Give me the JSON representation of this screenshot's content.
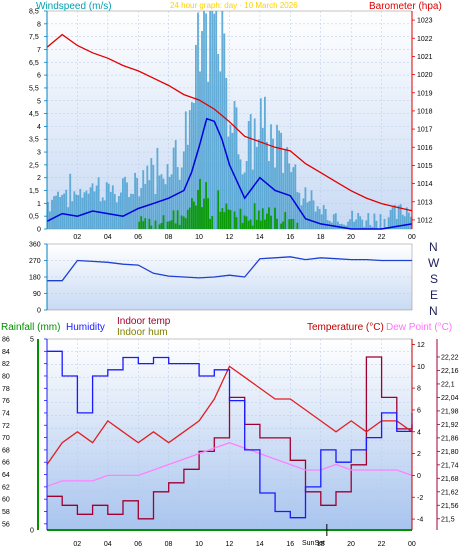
{
  "header": {
    "windspeed_label": "Windspeed (m/s)",
    "date_label": "24 hour graph: day · 10 March 2026",
    "barometer_label": "Barometer (hpa)"
  },
  "time_ticks": [
    "02",
    "04",
    "06",
    "08",
    "10",
    "12",
    "14",
    "16",
    "18",
    "20",
    "22",
    "00"
  ],
  "compass": [
    "N",
    "W",
    "S",
    "E",
    "N"
  ],
  "bottom_header": {
    "rainfall": "Rainfall (mm)",
    "humidity": "Humidity",
    "indoor_temp": "Indoor temp",
    "indoor_hum": "Indoor hum",
    "temperature": "Temperature (°C)",
    "dew_point": "Dew Point (°C)"
  },
  "sun_labels": {
    "sunset": "SunSet"
  },
  "colors": {
    "wind": "#1e90c8",
    "gust": "#4aa0d0",
    "avg": "#0000e0",
    "rain_bars": "#0a9a0a",
    "barometer": "#e00000",
    "humidity": "#1a1aff",
    "temp": "#e02020",
    "dewpoint": "#ff80ff",
    "indoor_temp": "#a00030",
    "rainfall": "#009000"
  },
  "chart_data": [
    {
      "type": "line",
      "title": "24 hour graph: day · 10 March 2026",
      "x_ticks": [
        "02",
        "04",
        "06",
        "08",
        "10",
        "12",
        "14",
        "16",
        "18",
        "20",
        "22",
        "00"
      ],
      "series": [
        {
          "name": "Windspeed (m/s)",
          "axis": "left",
          "ylim": [
            0,
            8.5
          ],
          "y_ticks": [
            "0",
            "0.5",
            "1",
            "1.5",
            "2",
            "2.5",
            "3",
            "3.5",
            "4",
            "4.5",
            "5",
            "5.5",
            "6",
            "6.5",
            "7",
            "7.5",
            "8",
            "8.5"
          ],
          "x": [
            0,
            1,
            2,
            3,
            4,
            5,
            6,
            7,
            8,
            9,
            9.5,
            10,
            10.5,
            11,
            11.5,
            12,
            13,
            14,
            15,
            16,
            17,
            18,
            19,
            20,
            21,
            22,
            23,
            24
          ],
          "values": [
            0.3,
            0.6,
            0.5,
            0.7,
            0.6,
            0.5,
            0.8,
            1.0,
            1.2,
            1.5,
            2.2,
            3.2,
            4.3,
            4.2,
            3.5,
            2.5,
            1.2,
            2.0,
            1.5,
            1.3,
            0.4,
            0.2,
            0.1,
            0.0,
            0.0,
            0.0,
            0.1,
            0.2
          ]
        },
        {
          "name": "Barometer (hpa)",
          "axis": "right",
          "ylim": [
            1011.5,
            1023.5
          ],
          "y_ticks": [
            "1012",
            "1013",
            "1014",
            "1015",
            "1016",
            "1017",
            "1018",
            "1019",
            "1020",
            "1021",
            "1022",
            "1023"
          ],
          "x": [
            0,
            1,
            2,
            3,
            4,
            5,
            6,
            7,
            8,
            9,
            10,
            11,
            12,
            13,
            14,
            15,
            16,
            17,
            18,
            19,
            20,
            21,
            22,
            23,
            24
          ],
          "values": [
            1021.5,
            1022.2,
            1021.6,
            1021.2,
            1020.9,
            1020.5,
            1020.2,
            1019.8,
            1019.4,
            1018.9,
            1018.6,
            1018.1,
            1017.4,
            1016.6,
            1016.3,
            1016.0,
            1015.8,
            1015.1,
            1014.6,
            1014.1,
            1013.6,
            1013.2,
            1012.9,
            1012.7,
            1012.5
          ]
        }
      ]
    },
    {
      "type": "line",
      "title": "",
      "x_ticks": [
        "02",
        "04",
        "06",
        "08",
        "10",
        "12",
        "14",
        "16",
        "18",
        "20",
        "22",
        "00"
      ],
      "series": [
        {
          "name": "Wind direction",
          "ylim": [
            0,
            360
          ],
          "y_ticks": [
            "0",
            "90",
            "180",
            "270",
            "360"
          ],
          "x": [
            0,
            1,
            2,
            3,
            4,
            5,
            6,
            7,
            8,
            9,
            10,
            11,
            12,
            13,
            14,
            15,
            16,
            17,
            18,
            19,
            20,
            21,
            22,
            23,
            24
          ],
          "values": [
            160,
            160,
            270,
            265,
            260,
            250,
            245,
            200,
            185,
            180,
            175,
            180,
            190,
            180,
            280,
            285,
            290,
            275,
            285,
            280,
            275,
            275,
            270,
            270,
            270
          ]
        }
      ]
    },
    {
      "type": "line",
      "title": "",
      "x_ticks": [
        "02",
        "04",
        "06",
        "08",
        "10",
        "12",
        "14",
        "16",
        "18",
        "20",
        "22",
        "00"
      ],
      "series": [
        {
          "name": "Humidity",
          "axis": "left",
          "ylim": [
            55,
            86
          ],
          "y_ticks": [
            "56",
            "58",
            "60",
            "62",
            "64",
            "66",
            "68",
            "70",
            "72",
            "74",
            "76",
            "78",
            "80",
            "82",
            "84",
            "86"
          ],
          "x": [
            0,
            1,
            2,
            3,
            4,
            5,
            6,
            7,
            8,
            9,
            10,
            11,
            12,
            13,
            14,
            15,
            16,
            17,
            18,
            19,
            20,
            21,
            22,
            23,
            24
          ],
          "values": [
            84,
            80,
            74,
            80,
            81,
            83,
            82,
            83,
            82,
            82,
            80,
            81,
            76,
            68,
            61,
            58,
            57,
            62,
            68,
            66,
            68,
            70,
            74,
            71,
            74
          ]
        },
        {
          "name": "Temperature (°C)",
          "axis": "right",
          "ylim": [
            -5,
            12.5
          ],
          "y_ticks": [
            "-4",
            "-2",
            "0",
            "2",
            "4",
            "6",
            "8",
            "10",
            "12"
          ],
          "x": [
            0,
            1,
            2,
            3,
            4,
            5,
            6,
            7,
            8,
            9,
            10,
            11,
            12,
            13,
            14,
            15,
            16,
            17,
            18,
            19,
            20,
            21,
            22,
            23,
            24
          ],
          "values": [
            1,
            3,
            4,
            3,
            5,
            4,
            3,
            4,
            3,
            4,
            5,
            7,
            10,
            9,
            8,
            7,
            7,
            6,
            5,
            4,
            5,
            4,
            5,
            5,
            4
          ]
        },
        {
          "name": "Dew Point (°C)",
          "axis": "right",
          "ylim": [
            -5,
            12.5
          ],
          "x": [
            0,
            1,
            2,
            3,
            4,
            5,
            6,
            7,
            8,
            9,
            10,
            11,
            12,
            13,
            14,
            15,
            16,
            17,
            18,
            19,
            20,
            21,
            22,
            23,
            24
          ],
          "values": [
            -1,
            -0.5,
            -0.5,
            -0.5,
            0,
            0,
            0,
            0.5,
            1,
            1.5,
            2,
            2.5,
            3,
            2.5,
            2,
            1.5,
            1,
            0.5,
            0.5,
            1,
            0.5,
            0.5,
            0.5,
            0.5,
            0
          ]
        },
        {
          "name": "Indoor temp",
          "axis": "right2",
          "ylim": [
            21.45,
            22.3
          ],
          "y_ticks": [
            "21,5",
            "21,56",
            "21,62",
            "21,68",
            "21,74",
            "21,80",
            "21,86",
            "21,92",
            "21,98",
            "22,04",
            "22,1",
            "22,16",
            "22,22"
          ],
          "x": [
            0,
            1,
            2,
            3,
            4,
            5,
            6,
            7,
            8,
            9,
            10,
            11,
            12,
            13,
            14,
            15,
            16,
            17,
            18,
            19,
            20,
            21,
            22,
            23,
            24
          ],
          "values": [
            21.6,
            21.56,
            21.52,
            21.56,
            21.52,
            21.58,
            21.5,
            21.62,
            21.66,
            21.72,
            21.8,
            21.86,
            22.04,
            21.92,
            21.86,
            21.86,
            21.76,
            21.62,
            21.56,
            21.62,
            21.74,
            22.22,
            22.04,
            21.9,
            21.92
          ]
        },
        {
          "name": "Rainfall (mm)",
          "axis": "rain",
          "ylim": [
            0,
            5
          ],
          "y_ticks": [
            "0",
            "5"
          ],
          "x": [
            0,
            24
          ],
          "values": [
            0,
            0
          ]
        }
      ]
    }
  ]
}
